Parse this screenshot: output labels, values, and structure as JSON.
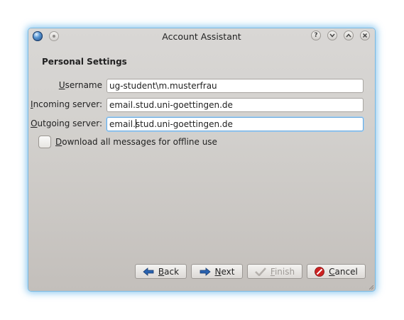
{
  "window": {
    "title": "Account Assistant",
    "titlebar_buttons": [
      "?",
      "v",
      "^",
      "x"
    ]
  },
  "section_heading": "Personal Settings",
  "fields": {
    "username": {
      "label_underlined": "U",
      "label_rest": "sername",
      "value": "ug-student\\m.musterfrau"
    },
    "incoming": {
      "label_underlined": "I",
      "label_rest": "ncoming server:",
      "value": "email.stud.uni-goettingen.de"
    },
    "outgoing": {
      "label_underlined": "O",
      "label_rest": "utgoing server:",
      "value_before_caret": "email.",
      "value_after_caret": "stud.uni-goettingen.de"
    }
  },
  "offline_checkbox": {
    "label_underlined": "D",
    "label_rest": "ownload all messages for offline use",
    "checked": false
  },
  "buttons": {
    "back": {
      "underlined": "B",
      "rest": "ack"
    },
    "next": {
      "underlined": "N",
      "rest": "ext"
    },
    "finish": {
      "underlined": "F",
      "rest": "inish",
      "disabled": true
    },
    "cancel": {
      "underlined": "C",
      "rest": "ancel"
    }
  },
  "colors": {
    "focus": "#6aa9dd",
    "window_glow": "#40a4e6",
    "cancel_icon": "#cc2222",
    "arrow_icon": "#2a63b0"
  }
}
